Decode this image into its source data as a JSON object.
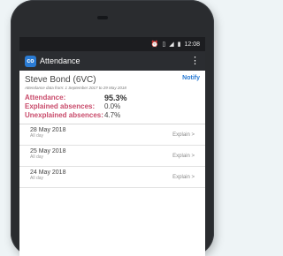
{
  "status_bar": {
    "icons": [
      "alarm-icon",
      "vibrate-icon",
      "signal-icon",
      "battery-icon"
    ],
    "time": "12:08"
  },
  "app_bar": {
    "logo_text": "co",
    "title": "Attendance",
    "menu_icon": "more-vert-icon"
  },
  "summary": {
    "student_name": "Steve Bond (6VC)",
    "notify_label": "Notify",
    "date_range": "Attendance data from: 1 September 2017 to 29 May 2018",
    "stats": [
      {
        "label": "Attendance:",
        "value": "95.3%"
      },
      {
        "label": "Explained absences:",
        "value": "0.0%"
      },
      {
        "label": "Unexplained absences:",
        "value": "4.7%"
      }
    ]
  },
  "absences": [
    {
      "date": "28 May 2018",
      "period": "All day",
      "action": "Explain >"
    },
    {
      "date": "25 May 2018",
      "period": "All day",
      "action": "Explain >"
    },
    {
      "date": "24 May 2018",
      "period": "All day",
      "action": "Explain >"
    }
  ],
  "colors": {
    "accent": "#2a7bd4",
    "label": "#c94b6b",
    "app_bar": "#2b2d31"
  }
}
